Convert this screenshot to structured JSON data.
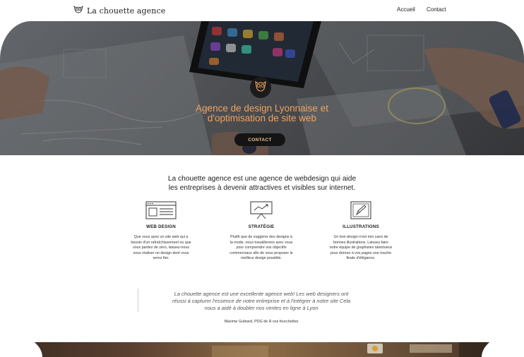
{
  "header": {
    "brand": "La chouette agence",
    "logo_icon": "owl-icon",
    "nav": [
      "Accueil",
      "Contact"
    ]
  },
  "hero": {
    "title_line1": "Agence de design Lyonnaise et",
    "title_line2": "d'optimisation de site web",
    "button_label": "CONTACT",
    "accent_color": "#f0a25c"
  },
  "intro": {
    "line1": "La chouette agence est une agence de webdesign qui aide",
    "line2": "les entreprises à devenir attractives et visibles sur internet."
  },
  "services": [
    {
      "icon": "browser-window-icon",
      "title": "WEB DESIGN",
      "lines": [
        "Que vous ayez un site web qui a",
        "besoin d'un rafraîchissement ou que",
        "vous partiez de zéro, laissez-nous",
        "vous réaliser un design dont vous",
        "serez fier."
      ]
    },
    {
      "icon": "presentation-board-icon",
      "title": "STRATÉGIE",
      "lines": [
        "Plutôt que de suggérer des designs à",
        "la mode, nous travaillerons avec vous",
        "pour comprendre vos objectifs",
        "commerciaux afin de vous proposer le",
        "meilleur design possible."
      ]
    },
    {
      "icon": "pencil-frame-icon",
      "title": "ILLUSTRATIONS",
      "lines": [
        "Un bon design n'est rien sans de",
        "bonnes illustrations. Laissez faire",
        "notre équipe de graphistes talentueux",
        "pour donner à vos pages une touche",
        "finale d'élégance."
      ]
    }
  ],
  "testimonial": {
    "line1": "La chouette agence est une excellente agence web! Les web designers ont",
    "line2": "réussi à capturer l'essence de notre entreprise et à l'intégrer à notre site Cela",
    "line3": "nous a aidé à doubler nos ventes en ligne à Lyon",
    "author": "Maxime Guibard, PDG de À vos fourchettes"
  }
}
